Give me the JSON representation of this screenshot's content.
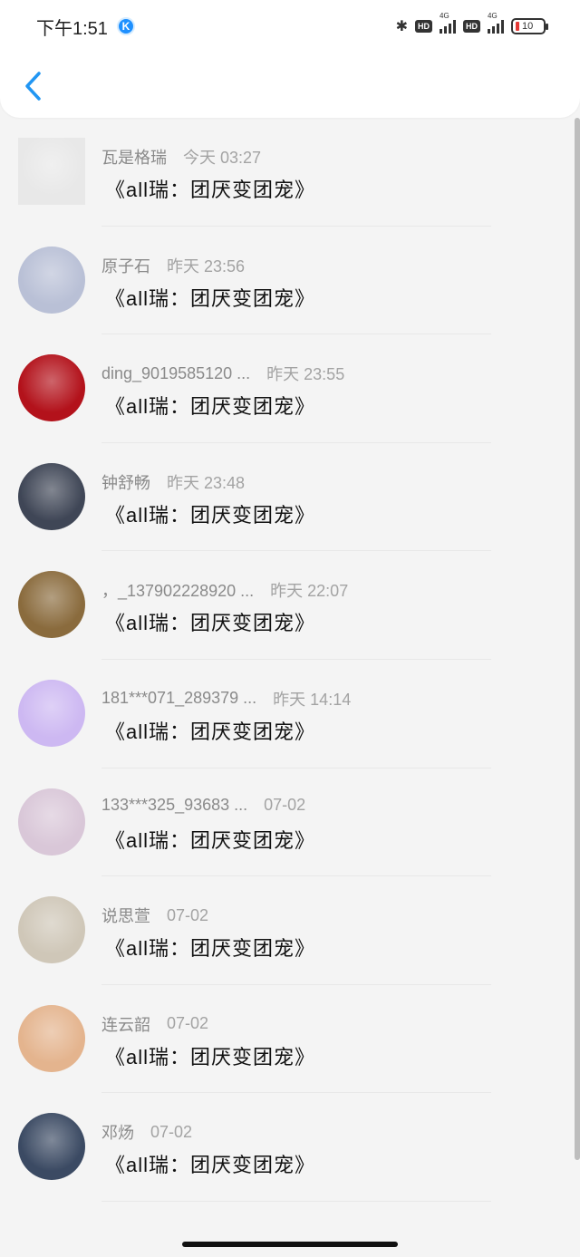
{
  "status_bar": {
    "time": "下午1:51",
    "app_badge": "K",
    "hd1": "HD",
    "net1": "4G",
    "hd2": "HD",
    "net2": "4G",
    "battery": "10",
    "battery_color": "#e53935"
  },
  "nav": {
    "back_icon": "chevron-left-icon",
    "accent": "#2196f3"
  },
  "items": [
    {
      "name": "瓦是格瑞",
      "time": "今天 03:27",
      "title": "《all瑞：团厌变团宠》",
      "avatar_color": "#e8e8e8"
    },
    {
      "name": "原子石",
      "time": "昨天 23:56",
      "title": "《all瑞：团厌变团宠》",
      "avatar_color": "#b9c0d6"
    },
    {
      "name": "ding_9019585120 ...",
      "time": "昨天 23:55",
      "title": "《all瑞：团厌变团宠》",
      "avatar_color": "#b3121b"
    },
    {
      "name": "钟舒畅",
      "time": "昨天 23:48",
      "title": "《all瑞：团厌变团宠》",
      "avatar_color": "#3f4656"
    },
    {
      "name": "，_137902228920 ...",
      "time": "昨天 22:07",
      "title": "《all瑞：团厌变团宠》",
      "avatar_color": "#8a6b3d"
    },
    {
      "name": "181***071_289379 ...",
      "time": "昨天 14:14",
      "title": "《all瑞：团厌变团宠》",
      "avatar_color": "#cdb8f2"
    },
    {
      "name": "133***325_93683 ...",
      "time": "07-02",
      "title": "《all瑞：团厌变团宠》",
      "avatar_color": "#d9c7d8"
    },
    {
      "name": "说思萱",
      "time": "07-02",
      "title": "《all瑞：团厌变团宠》",
      "avatar_color": "#cfc7b8"
    },
    {
      "name": "连云韶",
      "time": "07-02",
      "title": "《all瑞：团厌变团宠》",
      "avatar_color": "#e4b48e"
    },
    {
      "name": "邓炀",
      "time": "07-02",
      "title": "《all瑞：团厌变团宠》",
      "avatar_color": "#3b4a63"
    }
  ]
}
